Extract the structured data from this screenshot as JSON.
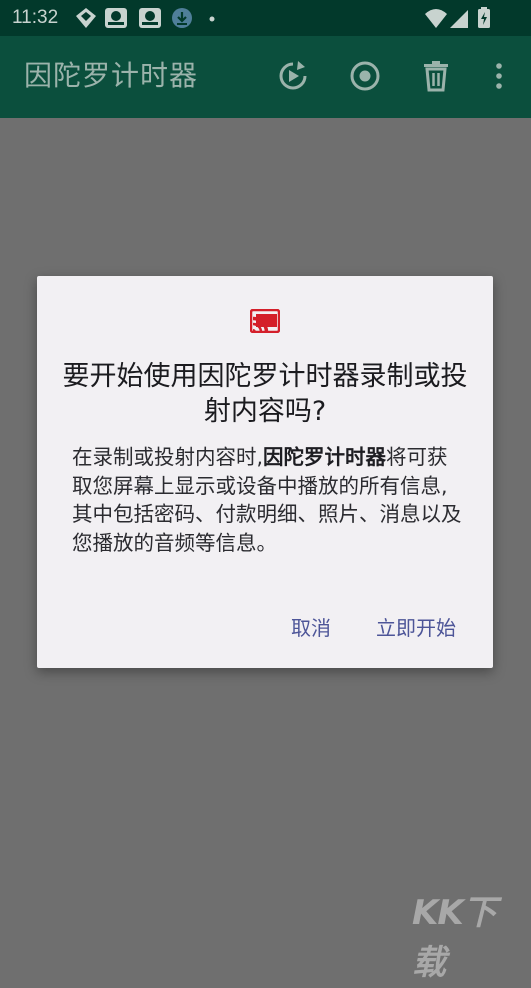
{
  "status_bar": {
    "time": "11:32"
  },
  "app_bar": {
    "title": "因陀罗计时器",
    "actions": [
      "replay-icon",
      "record-icon",
      "delete-icon",
      "more-vert-icon"
    ]
  },
  "dialog": {
    "icon": "cast-icon",
    "title": "要开始使用因陀罗计时器录制或投射内容吗?",
    "body_prefix": "在录制或投射内容时,",
    "body_app_name": "因陀罗计时器",
    "body_suffix": "将可获取您屏幕上显示或设备中播放的所有信息,其中包括密码、付款明细、照片、消息以及您播放的音频等信息。",
    "cancel_label": "取消",
    "start_label": "立即开始"
  },
  "watermark": {
    "text": "KK下载"
  },
  "colors": {
    "status_bar": "#02392b",
    "app_bar": "#0b4f3d",
    "scrim": "#6f6f6f",
    "dialog_bg": "#f2f0f3",
    "button_text": "#4d5598",
    "cast_icon": "#d41f2a"
  }
}
